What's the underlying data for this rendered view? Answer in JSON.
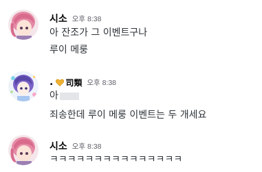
{
  "messages": [
    {
      "username": "시소",
      "timestamp": "오후 8:38",
      "avatar": "pink-haired-character-avatar",
      "lines": [
        "아 잔조가 그 이벤트구나",
        "루이 메룽"
      ]
    },
    {
      "username_prefix": ".",
      "tag": "司類",
      "tag_icon": "heart-icon",
      "timestamp": "오후 8:38",
      "avatar": "purple-haired-character-avatar",
      "lines": [
        "아",
        "죄송한데 루이 메룽 이벤트는 두 개세요"
      ]
    },
    {
      "username": "시소",
      "timestamp": "오후 8:38",
      "avatar": "pink-haired-character-avatar",
      "lines": [
        "ㅋㅋㅋㅋㅋㅋㅋㅋㅋㅋㅋㅋㅋㅋㅋ"
      ]
    }
  ],
  "colors": {
    "username": "#060607",
    "text": "#2e3338",
    "timestamp": "#5c5e66",
    "heart": "#f0b232"
  }
}
